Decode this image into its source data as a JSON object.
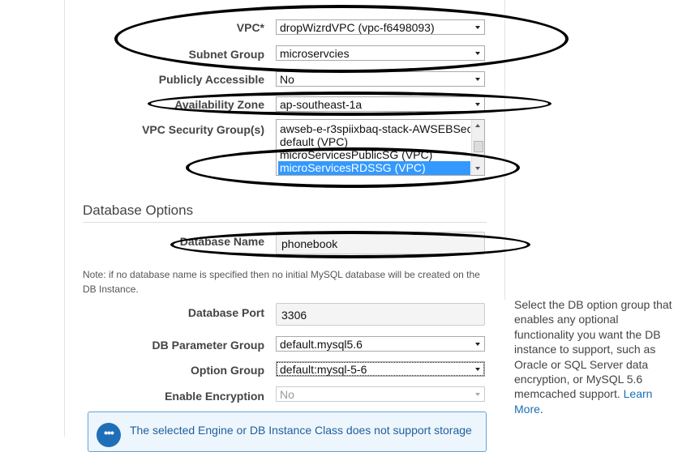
{
  "form": {
    "vpc": {
      "label": "VPC*",
      "value": "dropWizrdVPC (vpc-f6498093)"
    },
    "subnet_group": {
      "label": "Subnet Group",
      "value": "microservcies"
    },
    "publicly_accessible": {
      "label": "Publicly Accessible",
      "value": "No"
    },
    "availability_zone": {
      "label": "Availability Zone",
      "value": "ap-southeast-1a"
    },
    "vpc_security_groups": {
      "label": "VPC Security Group(s)",
      "options": [
        "awseb-e-r3spiixbaq-stack-AWSEBSec",
        "default (VPC)",
        "microServicesPublicSG (VPC)",
        "microServicesRDSSG (VPC)"
      ],
      "selected": "microServicesRDSSG (VPC)"
    }
  },
  "database_options": {
    "title": "Database Options",
    "database_name": {
      "label": "Database Name",
      "value": "phonebook"
    },
    "note": "Note: if no database name is specified then no initial MySQL database will be created on the DB Instance.",
    "database_port": {
      "label": "Database Port",
      "value": "3306"
    },
    "db_parameter_group": {
      "label": "DB Parameter Group",
      "value": "default.mysql5.6"
    },
    "option_group": {
      "label": "Option Group",
      "value": "default:mysql-5-6"
    },
    "enable_encryption": {
      "label": "Enable Encryption",
      "value": "No"
    }
  },
  "help": {
    "text": "Select the DB option group that enables any optional functionality you want the DB instance to support, such as Oracle or SQL Server data encryption, or MySQL 5.6 memcached support.",
    "link": "Learn More",
    "trailing": "."
  },
  "info_banner": {
    "icon": "ellipsis-icon",
    "icon_glyph": "•••",
    "text": "The selected Engine or DB Instance Class does not support storage"
  },
  "colors": {
    "accent_link": "#1a6fb5",
    "listbox_selection": "#3399ff",
    "info_border": "#62a3d9",
    "info_icon": "#1f6fb8",
    "annotation_ellipse": "#000000"
  }
}
